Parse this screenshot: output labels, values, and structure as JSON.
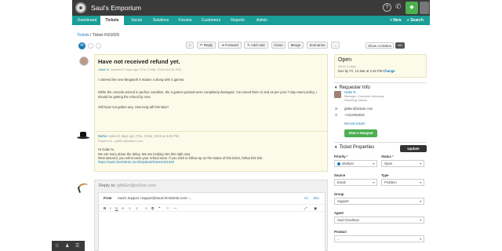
{
  "header": {
    "app_title": "Saul's Emporium",
    "help_icon": "question-circle-icon",
    "phone_icon": "phone-icon",
    "status_icon": "shield-icon",
    "avatar_icon": "avatar-icon"
  },
  "nav": {
    "items": [
      "Dashboard",
      "Tickets",
      "Social",
      "Solutions",
      "Forums",
      "Customers",
      "Reports",
      "Admin"
    ],
    "active": "Tickets",
    "new_label": "+ New",
    "search_label": "Search"
  },
  "breadcrumb": {
    "link": "Tickets",
    "current": " / Ticket #161029"
  },
  "toolbar": {
    "star": "☆",
    "reply": "Reply",
    "forward": "Forward",
    "add_note": "Add note",
    "close": "Close",
    "merge": "Merge",
    "scenarios": "Scenarios",
    "more": "...",
    "show_activities": "Show Activities",
    "toggle": "NO"
  },
  "ticket": {
    "title": "Have not received refund yet.",
    "author": "Gabe N.",
    "meta": " reported 2 days ago (Thu, 9 Mar, 2015 at 8:16 PM)",
    "p1": "I ordered the new Megasoft X station 4 along with 4 games.",
    "p2": "While the console arrived in perfect condition, the 4 games packed were completely damaged. I've turned them in and as per your 7-day return policy, I should be getting the refund by now.",
    "p3": "Still have not gotten any. How long will this take?"
  },
  "reply": {
    "author": "Barbe",
    "author_meta": " replied 2 days ago (Thu, 9 Mar, 2015 at 8:45 PM)",
    "replied_to": "Replied to : g8bEm@st3sm.com",
    "greeting": "Hi Gabe N.,",
    "line1": "We are sorry about the delay. We are looking into this right now.",
    "line2": "Rest assured, you will receive your refund soon. If you wish to follow up on the status of this ticket, follow this link:",
    "link": "https://sauls.freshdesk.com/helpdesk/tickets/161029"
  },
  "editor": {
    "reply_to_label": "Reply to:",
    "reply_to_addr": " g8bEm@st3sm.com",
    "from_label": "From",
    "from_value": "Saul's Support <support@sauls.freshdesk.com>",
    "cc": "Cc",
    "bcc": "Bcc",
    "format_tools": [
      "B",
      "I",
      "U",
      "A",
      "≡",
      "≡",
      "☺",
      "⧉",
      "❝",
      "⚐",
      "—"
    ]
  },
  "status": {
    "title": "Open",
    "sub": "Since 3 days",
    "due": "Due by Fri, 14 Mar at 2:45 PM",
    "change": "Change"
  },
  "requester": {
    "heading": "Requester Info",
    "name": "Gabe N.",
    "role": "Manager, Customer Advocacy",
    "role2": "Steaming Games",
    "email": "g8tten@st3am.com",
    "phone": "+1312053816",
    "recent": "Recent tickets",
    "hangout": "Start a Hangout",
    "email_icon": "email-icon",
    "phone_icon": "phone-icon"
  },
  "properties": {
    "heading": "Ticket Properties",
    "update": "Update",
    "priority_label": "Priority",
    "priority_value": "Medium",
    "status_label": "Status",
    "status_value": "Open",
    "source_label": "Source",
    "source_value": "Email",
    "type_label": "Type",
    "type_value": "Problem",
    "group_label": "Group",
    "group_value": "Support",
    "agent_label": "Agent",
    "agent_value": "Saul Goodman",
    "product_label": "Product",
    "product_value": "..."
  },
  "footer": {
    "icons": [
      "github-icon",
      "user-icon",
      "menu-icon"
    ]
  }
}
